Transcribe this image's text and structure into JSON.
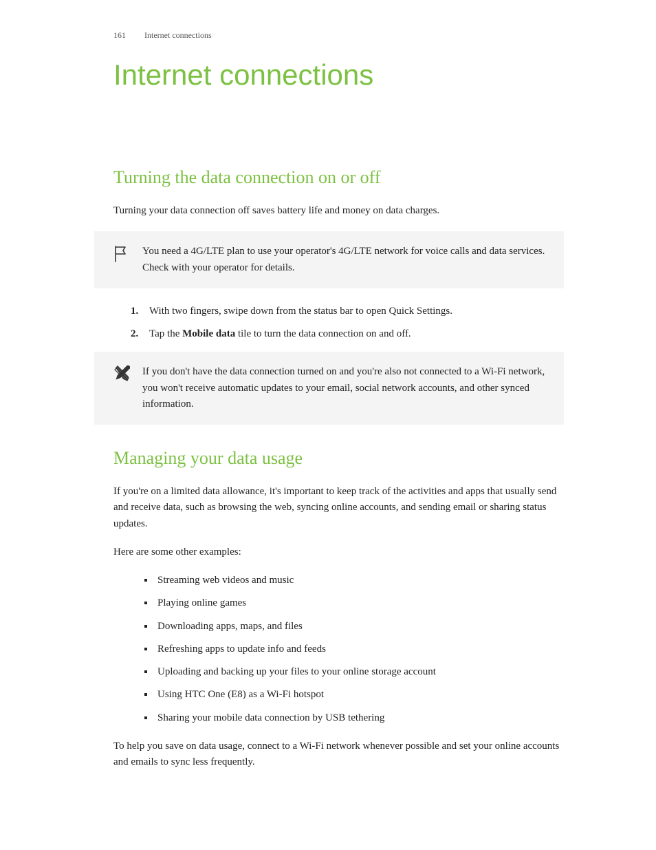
{
  "header": {
    "pageNumber": "161",
    "chapter": "Internet connections"
  },
  "title": "Internet connections",
  "section1": {
    "heading": "Turning the data connection on or off",
    "intro": "Turning your data connection off saves battery life and money on data charges.",
    "noteFlag": "You need a 4G/LTE plan to use your operator's 4G/LTE network for voice calls and data services. Check with your operator for details.",
    "step1": "With two fingers, swipe down from the status bar to open Quick Settings.",
    "step2_a": "Tap the ",
    "step2_bold": "Mobile data",
    "step2_b": " tile to turn the data connection on and off.",
    "notePencil": "If you don't have the data connection turned on and you're also not connected to a Wi-Fi network, you won't receive automatic updates to your email, social network accounts, and other synced information."
  },
  "section2": {
    "heading": "Managing your data usage",
    "para1": "If you're on a limited data allowance, it's important to keep track of the activities and apps that usually send and receive data, such as browsing the web, syncing online accounts, and sending email or sharing status updates.",
    "para2": "Here are some other examples:",
    "bullets": {
      "b0": "Streaming web videos and music",
      "b1": "Playing online games",
      "b2": "Downloading apps, maps, and files",
      "b3": "Refreshing apps to update info and feeds",
      "b4": "Uploading and backing up your files to your online storage account",
      "b5": "Using HTC One (E8) as a Wi-Fi hotspot",
      "b6": "Sharing your mobile data connection by USB tethering"
    },
    "closing": "To help you save on data usage, connect to a Wi-Fi network whenever possible and set your online accounts and emails to sync less frequently."
  }
}
